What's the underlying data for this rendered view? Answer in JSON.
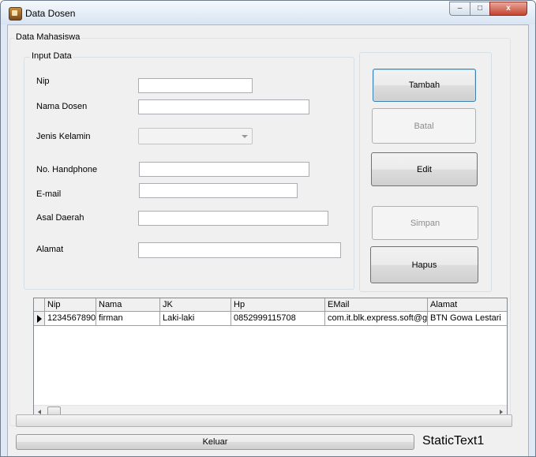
{
  "window": {
    "title": "Data Dosen",
    "controls": {
      "minimize": "–",
      "maximize": "□",
      "close": "x"
    }
  },
  "groups": {
    "outer": "Data Mahasiswa",
    "input": "Input Data"
  },
  "form": {
    "nip_label": "Nip",
    "nama_label": "Nama Dosen",
    "jk_label": "Jenis Kelamin",
    "hp_label": "No. Handphone",
    "email_label": "E-mail",
    "asal_label": "Asal Daerah",
    "alamat_label": "Alamat",
    "nip_value": "",
    "nama_value": "",
    "jk_value": "",
    "hp_value": "",
    "email_value": "",
    "asal_value": "",
    "alamat_value": ""
  },
  "buttons": {
    "tambah": "Tambah",
    "batal": "Batal",
    "edit": "Edit",
    "simpan": "Simpan",
    "hapus": "Hapus",
    "keluar": "Keluar"
  },
  "grid": {
    "columns": [
      "Nip",
      "Nama",
      "JK",
      "Hp",
      "EMail",
      "Alamat"
    ],
    "rows": [
      [
        "1234567890",
        "firman",
        "Laki-laki",
        "0852999115708",
        "com.it.blk.express.soft@g",
        "BTN Gowa Lestari"
      ]
    ]
  },
  "static_text": "StaticText1",
  "colors": {
    "accent_focus": "#3c7fb1",
    "close_button": "#c4432f"
  }
}
